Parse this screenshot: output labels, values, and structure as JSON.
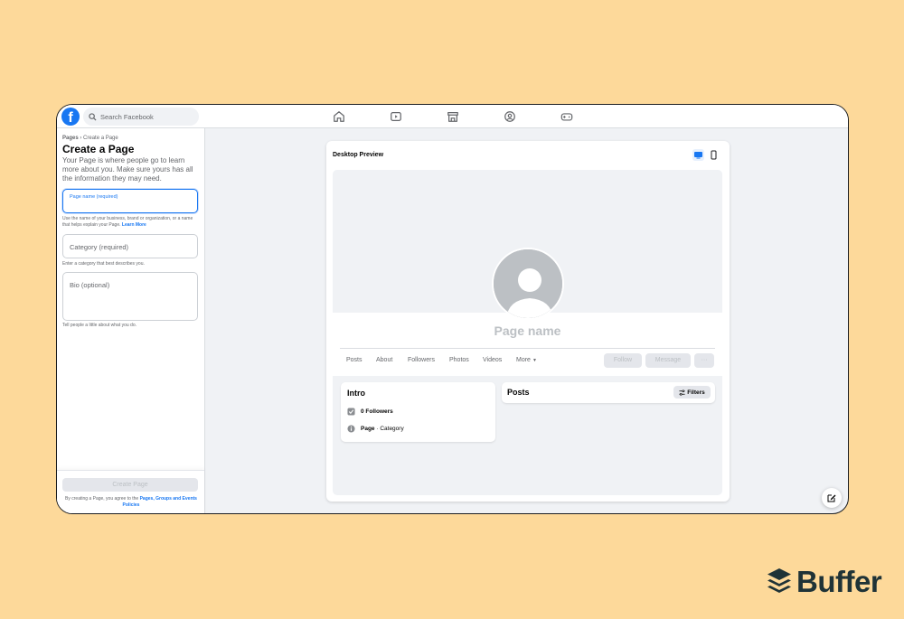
{
  "topbar": {
    "logo": "f",
    "search_placeholder": "Search Facebook",
    "nav_icons": [
      "home-icon",
      "watch-icon",
      "marketplace-icon",
      "groups-icon",
      "gaming-icon"
    ]
  },
  "left_panel": {
    "breadcrumb_root": "Pages",
    "breadcrumb_sep": "›",
    "breadcrumb_current": "Create a Page",
    "title": "Create a Page",
    "description": "Your Page is where people go to learn more about you. Make sure yours has all the information they may need.",
    "page_name_label": "Page name (required)",
    "page_name_help": "Use the name of your business, brand or organization, or a name that helps explain your Page.",
    "learn_more": "Learn More",
    "category_placeholder": "Category (required)",
    "category_help": "Enter a category that best describes you.",
    "bio_placeholder": "Bio (optional)",
    "bio_help": "Tell people a little about what you do.",
    "create_button": "Create Page",
    "terms_text": "By creating a Page, you agree to the",
    "terms_link": "Pages, Groups and Events Policies"
  },
  "preview": {
    "title": "Desktop Preview",
    "page_name": "Page name",
    "tabs": [
      "Posts",
      "About",
      "Followers",
      "Photos",
      "Videos",
      "More"
    ],
    "follow_button": "Follow",
    "message_button": "Message",
    "more_button": "···",
    "intro_title": "Intro",
    "followers_text": "0 Followers",
    "page_label": "Page",
    "category_text": " · Category",
    "posts_title": "Posts",
    "filters_button": "Filters"
  },
  "brand": {
    "name": "Buffer",
    "color": "#1f3337"
  },
  "colors": {
    "background": "#fdd99a",
    "facebook_blue": "#1877f2"
  }
}
